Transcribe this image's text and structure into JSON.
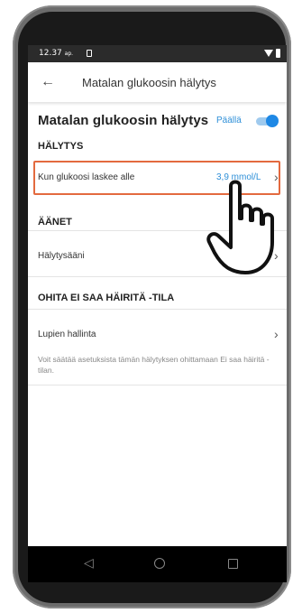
{
  "status_bar": {
    "time": "12.37",
    "ampm": "ap."
  },
  "app_bar": {
    "title": "Matalan glukoosin hälytys"
  },
  "header": {
    "title": "Matalan glukoosin hälytys",
    "state": "Päällä"
  },
  "sections": {
    "alarm": {
      "label": "HÄLYTYS"
    },
    "sounds": {
      "label": "ÄÄNET"
    },
    "override": {
      "label": "OHITA EI SAA HÄIRITÄ -TILA"
    }
  },
  "rows": {
    "threshold": {
      "label": "Kun glukoosi laskee alle",
      "value": "3,9 mmol/L"
    },
    "tone": {
      "label": "Hälytysääni"
    },
    "permissions": {
      "label": "Lupien hallinta"
    }
  },
  "description": "Voit säätää asetuksista tämän hälytyksen ohittamaan Ei saa häiritä -tilan.",
  "colors": {
    "accent": "#1e88e5",
    "highlight": "#e36a3f"
  }
}
